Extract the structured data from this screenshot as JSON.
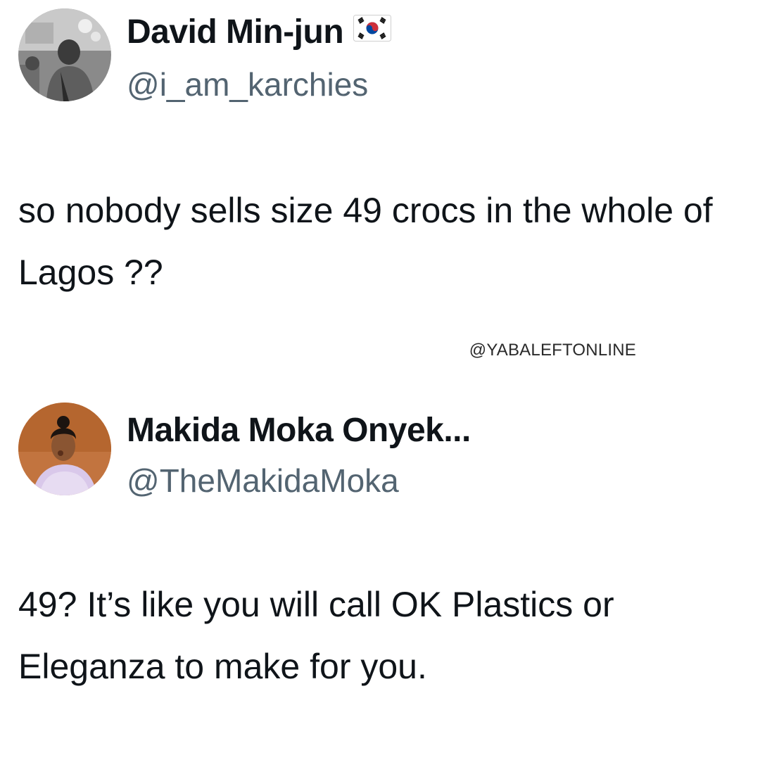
{
  "tweets": [
    {
      "display_name": "David Min-jun",
      "flag_icon": "south-korea-flag-icon",
      "handle": "@i_am_karchies",
      "text": "so nobody sells size 49 crocs in the whole of Lagos ??"
    },
    {
      "display_name": "Makida Moka Onyek...",
      "handle": "@TheMakidaMoka",
      "text": "49? It’s like you will call OK Plastics or Eleganza to make for you."
    }
  ],
  "watermark": "@YABALEFTONLINE",
  "colors": {
    "text": "#0f1419",
    "handle": "#536471",
    "background": "#ffffff"
  }
}
